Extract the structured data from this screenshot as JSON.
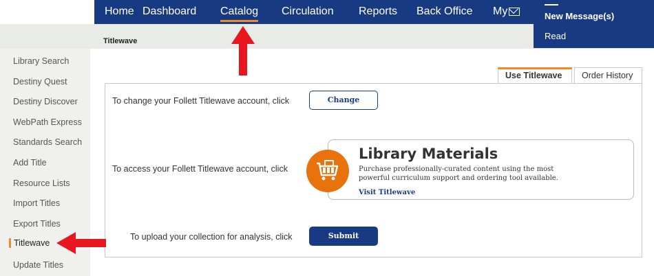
{
  "nav": {
    "items": [
      {
        "label": "Home"
      },
      {
        "label": "Dashboard"
      },
      {
        "label": "Catalog"
      },
      {
        "label": "Circulation"
      },
      {
        "label": "Reports"
      },
      {
        "label": "Back Office"
      },
      {
        "label": "My"
      }
    ],
    "active": "Catalog"
  },
  "messages": {
    "new_label": "New Message(s)",
    "read_label": "Read"
  },
  "breadcrumb": "Titlewave",
  "sidebar": {
    "items": [
      {
        "label": "Library Search"
      },
      {
        "label": "Destiny Quest"
      },
      {
        "label": "Destiny Discover"
      },
      {
        "label": "WebPath Express"
      },
      {
        "label": "Standards Search"
      },
      {
        "label": "Add Title"
      },
      {
        "label": "Resource Lists"
      },
      {
        "label": "Import Titles"
      },
      {
        "label": "Export Titles"
      },
      {
        "label": "Titlewave"
      },
      {
        "label": "Update Titles"
      }
    ],
    "active": "Titlewave"
  },
  "tabs": [
    {
      "label": "Use Titlewave"
    },
    {
      "label": "Order History"
    }
  ],
  "main": {
    "change_text": "To change your Follett Titlewave account, click",
    "change_button": "Change",
    "access_text": "To access your Follett Titlewave account, click",
    "upload_text": "To upload your collection for analysis, click",
    "submit_button": "Submit"
  },
  "library_materials": {
    "title": "Library Materials",
    "description": "Purchase professionally-curated content using the most powerful curriculum support and ordering tool available.",
    "link": "Visit Titlewave"
  },
  "colors": {
    "brand_navy": "#183a82",
    "accent_orange": "#f08a24",
    "cart_orange": "#e8720c",
    "annotation_red": "#e8171f"
  },
  "icons": [
    "mail-icon",
    "shopping-cart-icon",
    "red-arrow-annotation"
  ]
}
